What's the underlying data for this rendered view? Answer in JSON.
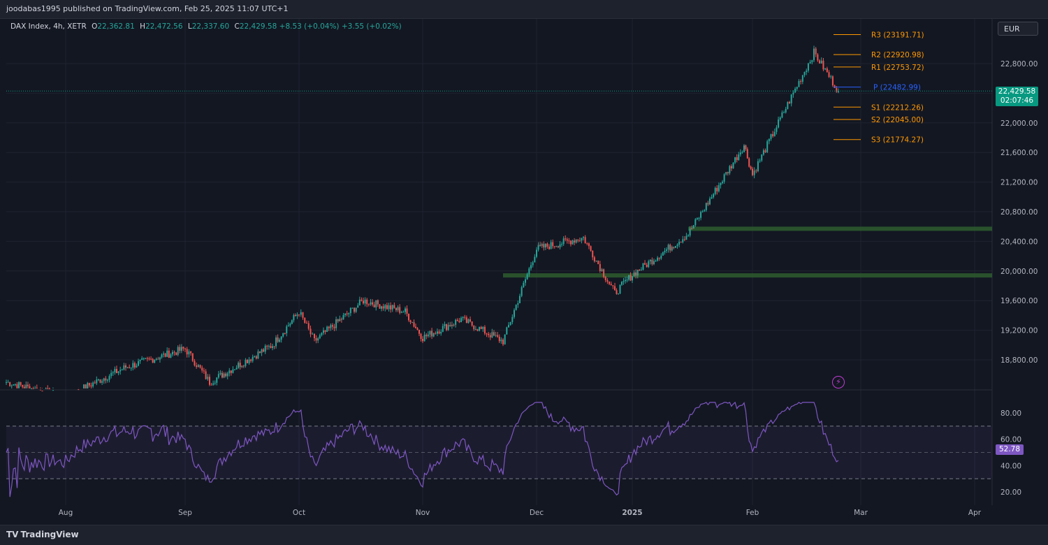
{
  "header": {
    "published": "joodabas1995 published on TradingView.com, Feb 25, 2025 11:07 UTC+1"
  },
  "legend": {
    "symbol": "DAX Index, 4h, XETR",
    "o_label": "O",
    "o_value": "22,362.81",
    "h_label": "H",
    "h_value": "22,472.56",
    "l_label": "L",
    "l_value": "22,337.60",
    "c_label": "C",
    "c_value": "22,429.58",
    "change": "+8.53 (+0.04%)",
    "change2": "+3.55 (+0.02%)"
  },
  "currency_button": "EUR",
  "last_price": {
    "value": "22,429.58",
    "countdown": "02:07:46"
  },
  "rsi_value": "52.78",
  "footer": {
    "brand": "TradingView"
  },
  "colors": {
    "up": "#26a69a",
    "down": "#ef5350",
    "pivot_orange": "#ff9800",
    "pivot_blue": "#2962ff",
    "rsi": "#7e57c2",
    "zone_green": "#2e5d2e"
  },
  "chart_data": {
    "type": "candlestick",
    "timeframe": "4h",
    "price_axis": {
      "ticks": [
        "22,800.00",
        "22,400.00",
        "22,000.00",
        "21,600.00",
        "21,200.00",
        "20,800.00",
        "20,400.00",
        "20,000.00",
        "19,600.00",
        "19,200.00",
        "18,800.00"
      ],
      "ylim": [
        18400,
        23400
      ]
    },
    "time_axis": {
      "ticks": [
        "Aug",
        "Sep",
        "Oct",
        "Nov",
        "Dec",
        "2025",
        "Feb",
        "Mar",
        "Apr"
      ]
    },
    "pivots": [
      {
        "label": "R3 (23191.71)",
        "value": 23191.71
      },
      {
        "label": "R2 (22920.98)",
        "value": 22920.98
      },
      {
        "label": "R1 (22753.72)",
        "value": 22753.72
      },
      {
        "label": "P (22482.99)",
        "value": 22482.99
      },
      {
        "label": "S1 (22212.26)",
        "value": 22212.26
      },
      {
        "label": "S2 (22045.00)",
        "value": 22045.0
      },
      {
        "label": "S3 (21774.27)",
        "value": 21774.27
      }
    ],
    "zones": [
      {
        "price": 20570,
        "from": "mid-Jan"
      },
      {
        "price": 19940,
        "from": "late-Nov"
      }
    ],
    "price_path": [
      [
        "Jul",
        18500
      ],
      [
        "Aug",
        18300
      ],
      [
        "mid-Aug",
        18700
      ],
      [
        "Sep",
        18950
      ],
      [
        "mid-Sep",
        18500
      ],
      [
        "late-Sep",
        19000
      ],
      [
        "Oct",
        19450
      ],
      [
        "early-Oct",
        19050
      ],
      [
        "mid-Oct",
        19600
      ],
      [
        "late-Oct",
        19450
      ],
      [
        "Nov",
        19100
      ],
      [
        "mid-Nov",
        19350
      ],
      [
        "late-Nov",
        19050
      ],
      [
        "Dec",
        20300
      ],
      [
        "mid-Dec",
        20450
      ],
      [
        "late-Dec",
        19700
      ],
      [
        "2025",
        19950
      ],
      [
        "mid-Jan",
        20500
      ],
      [
        "late-Jan",
        21700
      ],
      [
        "Feb",
        21300
      ],
      [
        "mid-Feb",
        22300
      ],
      [
        "Feb-18",
        22950
      ],
      [
        "Feb-25",
        22430
      ]
    ],
    "rsi": {
      "levels": [
        "80.00",
        "60.00",
        "40.00",
        "20.00"
      ],
      "upper_band": 70,
      "lower_band": 30,
      "last": 52.78
    }
  }
}
